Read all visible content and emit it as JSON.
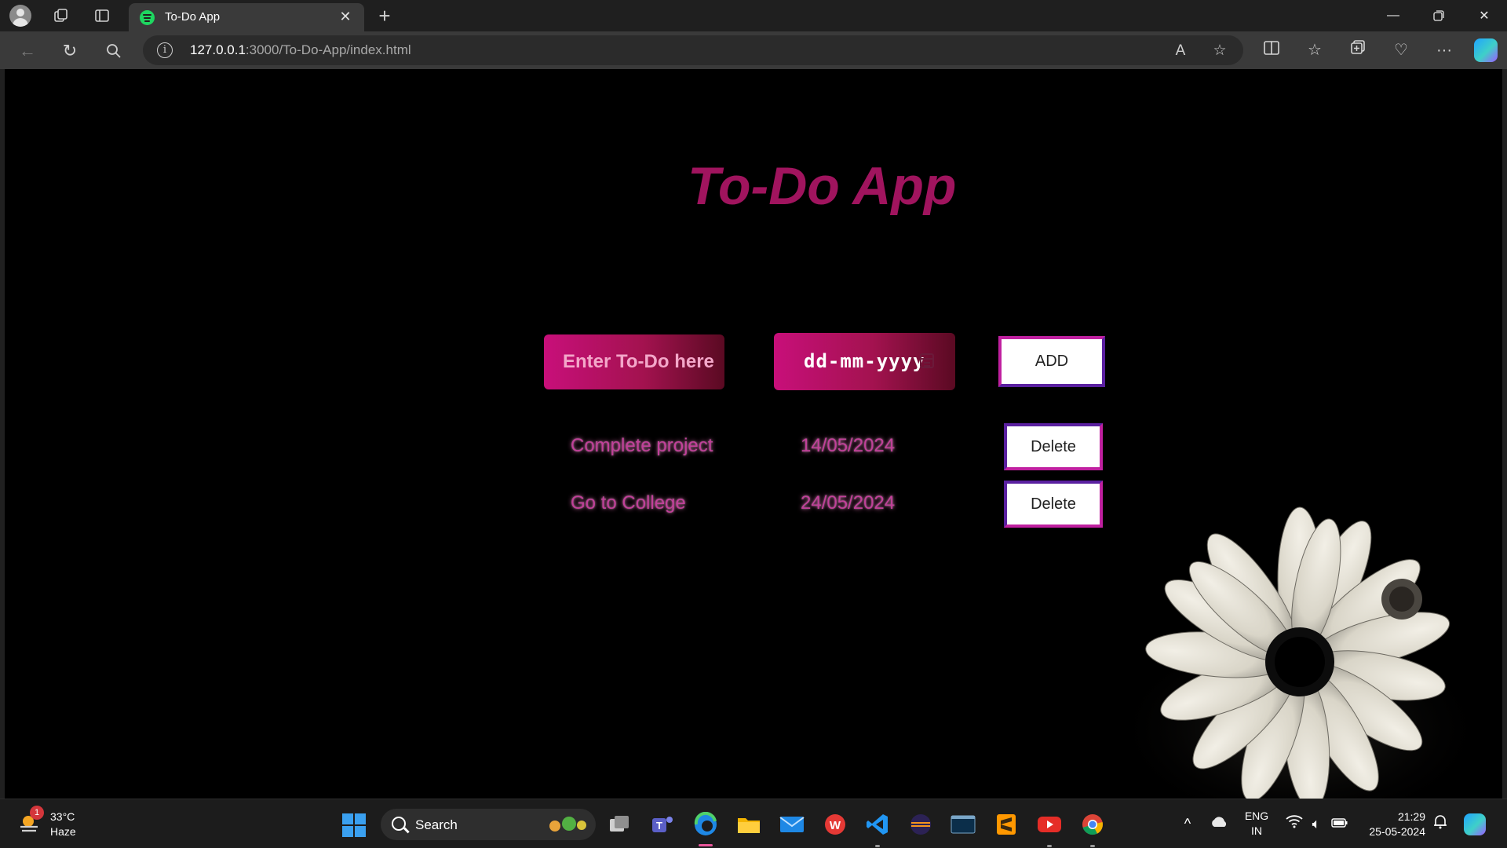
{
  "browser": {
    "tab_title": "To-Do App",
    "url_host": "127.0.0.1",
    "url_rest": ":3000/To-Do-App/index.html"
  },
  "page": {
    "title": "To-Do App",
    "todo_placeholder": "Enter To-Do here",
    "date_placeholder": "dd-mm-yyyy",
    "add_label": "ADD",
    "todos": [
      {
        "text": "Complete project",
        "date": "14/05/2024",
        "delete_label": "Delete"
      },
      {
        "text": "Go to College",
        "date": "24/05/2024",
        "delete_label": "Delete"
      }
    ]
  },
  "taskbar": {
    "weather_temp": "33°C",
    "weather_desc": "Haze",
    "weather_badge": "1",
    "search_label": "Search",
    "lang_top": "ENG",
    "lang_bottom": "IN",
    "time": "21:29",
    "date": "25-05-2024"
  },
  "colors": {
    "accent_pink": "#c80f7a",
    "title_magenta": "#a0145e",
    "page_background": "#000000"
  },
  "icons": [
    "profile-icon",
    "workspaces-icon",
    "tab-actions-icon",
    "spotify-icon",
    "back-icon",
    "refresh-icon",
    "search-icon",
    "info-icon",
    "read-aloud-icon",
    "favorite-icon",
    "split-screen-icon",
    "favorites-icon",
    "collections-icon",
    "browser-essentials-icon",
    "more-icon",
    "copilot-icon",
    "calendar-icon",
    "flower-image",
    "windows-start-icon",
    "task-view-icon",
    "teams-icon",
    "edge-icon",
    "file-explorer-icon",
    "mail-icon",
    "wps-icon",
    "vscode-icon",
    "eclipse-icon",
    "mysql-icon",
    "sublime-icon",
    "youtube-icon",
    "chrome-icon"
  ]
}
